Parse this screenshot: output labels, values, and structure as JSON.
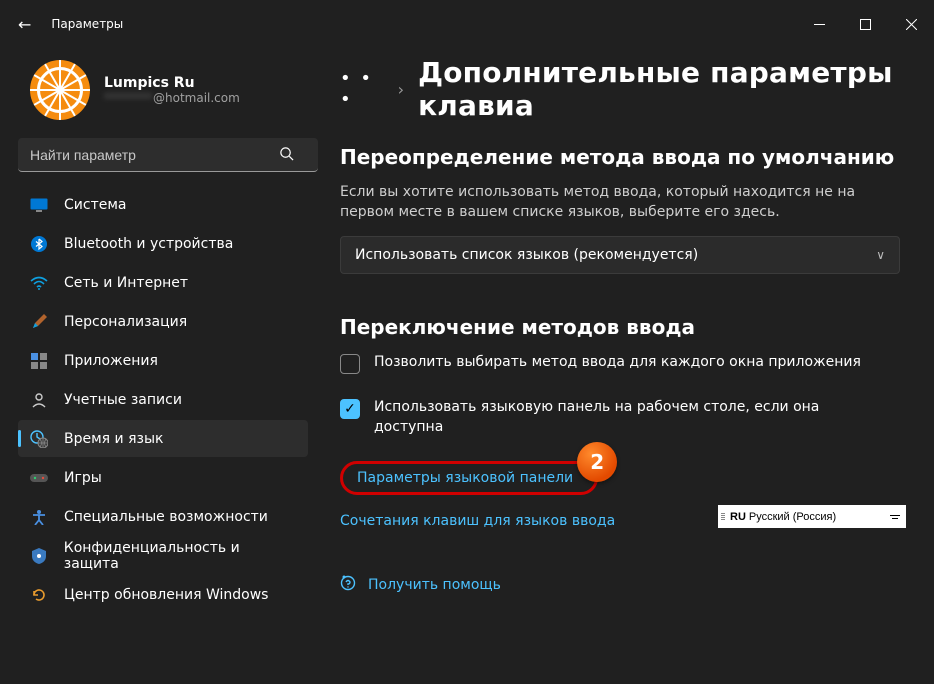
{
  "window": {
    "title": "Параметры"
  },
  "profile": {
    "name": "Lumpics Ru",
    "email_hidden": "********",
    "email_domain": "@hotmail.com"
  },
  "search": {
    "placeholder": "Найти параметр"
  },
  "nav": {
    "items": [
      {
        "label": "Система",
        "icon": "system"
      },
      {
        "label": "Bluetooth и устройства",
        "icon": "bluetooth"
      },
      {
        "label": "Сеть и Интернет",
        "icon": "wifi"
      },
      {
        "label": "Персонализация",
        "icon": "brush"
      },
      {
        "label": "Приложения",
        "icon": "apps"
      },
      {
        "label": "Учетные записи",
        "icon": "account"
      },
      {
        "label": "Время и язык",
        "icon": "clock",
        "active": true
      },
      {
        "label": "Игры",
        "icon": "gamepad"
      },
      {
        "label": "Специальные возможности",
        "icon": "accessibility"
      },
      {
        "label": "Конфиденциальность и защита",
        "icon": "shield"
      },
      {
        "label": "Центр обновления Windows",
        "icon": "update"
      }
    ]
  },
  "breadcrumb": {
    "dots": "• • •",
    "chevron": "›",
    "title": "Дополнительные параметры клавиа"
  },
  "section1": {
    "heading": "Переопределение метода ввода по умолчанию",
    "desc": "Если вы хотите использовать метод ввода, который находится не на первом месте в вашем списке языков, выберите его здесь.",
    "dropdown_value": "Использовать список языков (рекомендуется)"
  },
  "section2": {
    "heading": "Переключение методов ввода",
    "check1": "Позволить выбирать метод ввода для каждого окна приложения",
    "check2": "Использовать языковую панель на рабочем столе, если она доступна",
    "link1": "Параметры языковой панели",
    "link2": "Сочетания клавиш для языков ввода"
  },
  "help": {
    "label": "Получить помощь"
  },
  "annotation": {
    "badge": "2"
  },
  "langbar": {
    "code": "RU",
    "name": "Русский (Россия)"
  }
}
